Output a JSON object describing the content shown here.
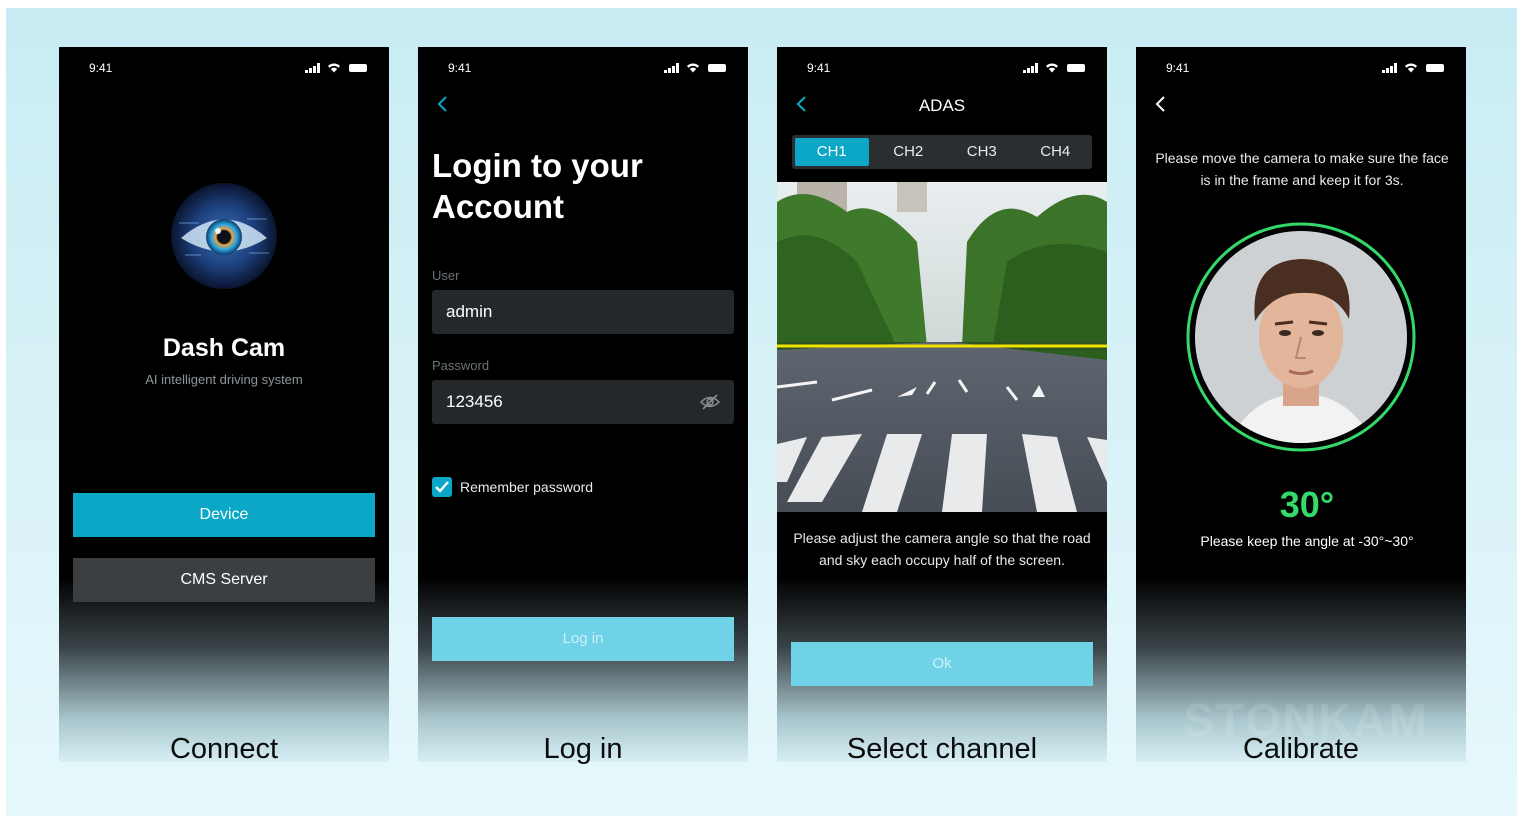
{
  "status_time": "9:41",
  "screens": {
    "connect": {
      "title": "Dash Cam",
      "subtitle": "AI intelligent driving system",
      "device_label": "Device",
      "cms_label": "CMS Server",
      "caption": "Connect"
    },
    "login": {
      "title": "Login to your Account",
      "user_label": "User",
      "user_value": "admin",
      "password_label": "Password",
      "password_value": "123456",
      "remember_label": "Remember password",
      "remember_checked": true,
      "login_label": "Log in",
      "caption": "Log in"
    },
    "channel": {
      "title": "ADAS",
      "tabs": [
        "CH1",
        "CH2",
        "CH3",
        "CH4"
      ],
      "active_tab": "CH1",
      "hint": "Please adjust the camera angle so that the road and sky each occupy half of the screen.",
      "ok_label": "Ok",
      "caption": "Select channel"
    },
    "calibrate": {
      "hint": "Please move the camera to make sure the face is in the frame and keep it for 3s.",
      "angle": "30°",
      "angle_hint": "Please keep the angle at -30°~30°",
      "watermark": "STONKAM",
      "caption": "Calibrate"
    }
  },
  "colors": {
    "accent": "#0aa7c6",
    "accent_disabled": "#6fd2e6",
    "calibration_green": "#33d96b",
    "horizon_line": "#f2e200"
  },
  "icons": [
    "signal-icon",
    "wifi-icon",
    "battery-icon",
    "back-chevron-icon",
    "eye-logo-icon",
    "password-hidden-icon",
    "checkbox-checked-icon"
  ]
}
